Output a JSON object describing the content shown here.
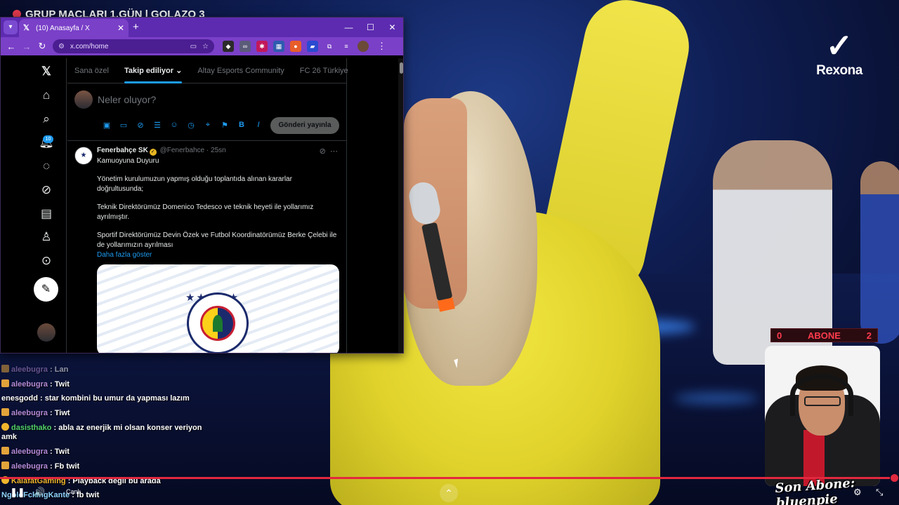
{
  "stream": {
    "title": "GRUP MAÇLARI 1.GÜN | GOLAZO 3",
    "sponsor": "Rexona",
    "sponsor_mark": "✓",
    "goal": {
      "left": "0",
      "label": "ABONE",
      "right": "2"
    },
    "last_sub": "Son Abone: bluenpie",
    "live_label": "Canlı",
    "progress_percent": 99
  },
  "chat": [
    {
      "user": "aleebugra",
      "msg": " : Lan",
      "color": "#b48ad8",
      "faded": true,
      "badge": "sub"
    },
    {
      "user": "aleebugra",
      "msg": " : Twit",
      "color": "#b48ad8",
      "badge": "sub"
    },
    {
      "user": "enesgodd",
      "msg": " : star kombini bu umur da yapması lazım",
      "color": "#ffffff",
      "badge": ""
    },
    {
      "user": "aleebugra",
      "msg": " : Tiwt",
      "color": "#b48ad8",
      "badge": "sub"
    },
    {
      "user": "dasisthako",
      "msg": " : abla az enerjik mi olsan konser veriyon amk",
      "color": "#51d16a",
      "badge": "gold"
    },
    {
      "user": "aleebugra",
      "msg": " : Twit",
      "color": "#b48ad8",
      "badge": "sub"
    },
    {
      "user": "aleebugra",
      "msg": " : Fb twit",
      "color": "#b48ad8",
      "badge": "sub"
    },
    {
      "user": "KalafatGaming",
      "msg": " : Playback değil bu arada",
      "color": "#f0b52c",
      "badge": "gold"
    },
    {
      "user": "NgoloFckingKante",
      "msg": " : fb twit",
      "color": "#8fd3ff",
      "badge": ""
    }
  ],
  "browser": {
    "tab_title": "(10) Anasayfa / X",
    "url": "x.com/home",
    "window_controls": {
      "minimize": "—",
      "maximize": "☐",
      "close": "✕"
    }
  },
  "x": {
    "notif_count": "10",
    "tabs": [
      "Sana özel",
      "Takip ediliyor",
      "Altay Esports Community",
      "FC 26 Türkiye"
    ],
    "active_tab": "Takip ediliyor",
    "composer_placeholder": "Neler oluyor?",
    "composer_submit": "Gönderi yayınla",
    "tweet": {
      "name": "Fenerbahçe SK",
      "handle": "@Fenerbahce · 25sn",
      "paragraphs": [
        "Kamuoyuna Duyuru",
        "Yönetim kurulumuzun yapmış olduğu toplantıda alınan kararlar doğrultusunda;",
        "Teknik Direktörümüz Domenico Tedesco ve teknik heyeti ile yollarımız ayrılmıştır.",
        "Sportif Direktörümüz Devin Özek ve Futbol Koordinatörümüz Berke Çelebi ile de yollarımızın ayrılması"
      ],
      "show_more": "Daha fazla göster"
    }
  },
  "colors": {
    "x_blue": "#1d9bf0",
    "browser_purple": "#7a40c8",
    "live_red": "#e2283e"
  }
}
